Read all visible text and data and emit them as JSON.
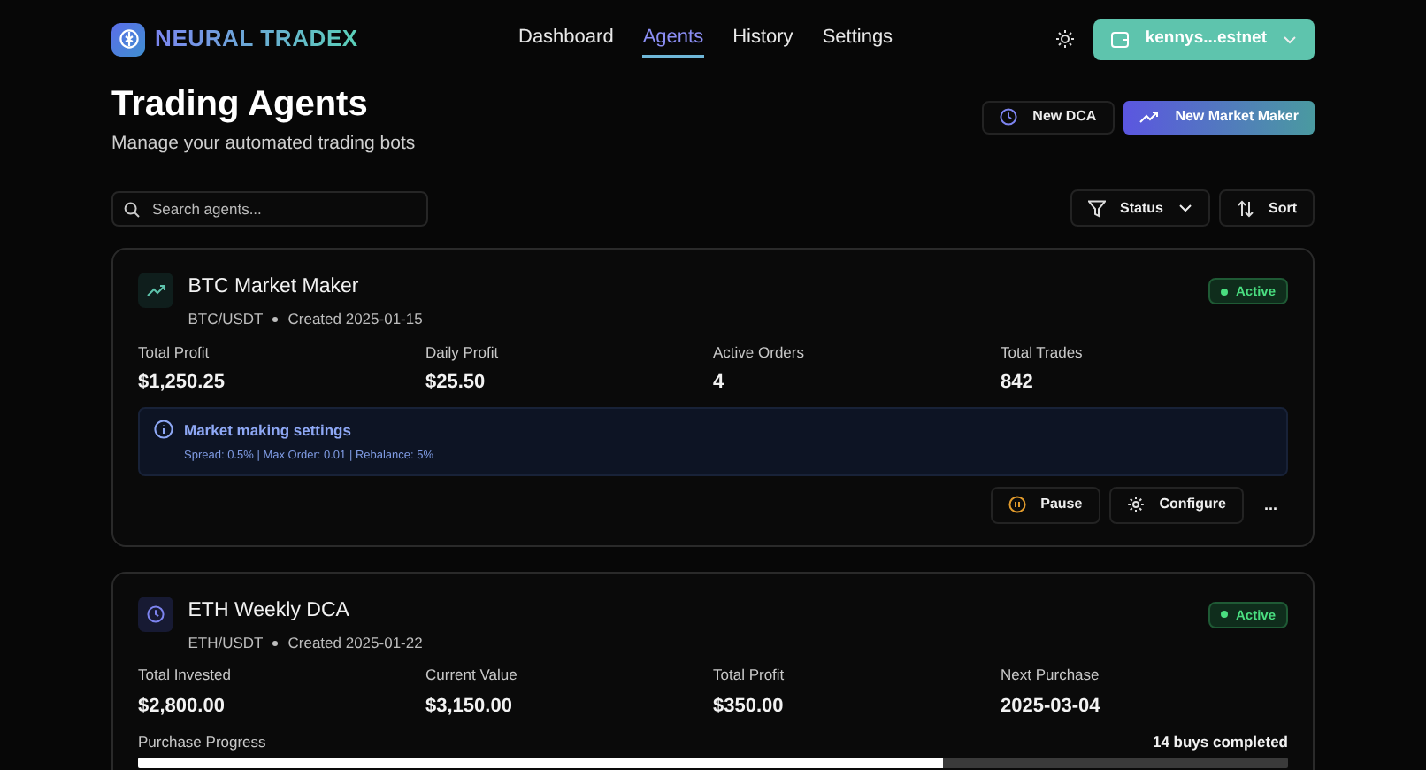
{
  "brand": {
    "name": "NEURAL TRADEX"
  },
  "nav": [
    {
      "label": "Dashboard",
      "selected": false
    },
    {
      "label": "Agents",
      "selected": true
    },
    {
      "label": "History",
      "selected": false
    },
    {
      "label": "Settings",
      "selected": false
    }
  ],
  "wallet": {
    "label": "kennys...estnet"
  },
  "header": {
    "title": "Trading Agents",
    "subtitle": "Manage your automated trading bots"
  },
  "actions": [
    {
      "kind": "dca",
      "label": "New DCA"
    },
    {
      "kind": "market_maker",
      "label": "New Market Maker"
    }
  ],
  "search": {
    "placeholder": "Search agents..."
  },
  "filters": [
    {
      "kind": "status",
      "label": "Status"
    },
    {
      "kind": "sort",
      "label": "Sort"
    }
  ],
  "agents": [
    {
      "kind": "market_maker",
      "name": "BTC Market Maker",
      "pair": "BTC/USDT",
      "created": "Created 2025-01-15",
      "status": "Active",
      "stats": [
        {
          "label": "Total Profit",
          "value": "$1,250.25"
        },
        {
          "label": "Daily Profit",
          "value": "$25.50"
        },
        {
          "label": "Active Orders",
          "value": "4"
        },
        {
          "label": "Total Trades",
          "value": "842"
        }
      ],
      "info": {
        "title": "Market making settings",
        "details": "Spread: 0.5% | Max Order: 0.01 | Rebalance: 5%"
      },
      "buttons": [
        {
          "kind": "pause",
          "label": "Pause"
        },
        {
          "kind": "configure",
          "label": "Configure"
        },
        {
          "kind": "more",
          "label": "..."
        }
      ]
    },
    {
      "kind": "dca",
      "name": "ETH Weekly DCA",
      "pair": "ETH/USDT",
      "created": "Created 2025-01-22",
      "status": "Active",
      "stats": [
        {
          "label": "Total Invested",
          "value": "$2,800.00"
        },
        {
          "label": "Current Value",
          "value": "$3,150.00"
        },
        {
          "label": "Total Profit",
          "value": "$350.00"
        },
        {
          "label": "Next Purchase",
          "value": "2025-03-04"
        }
      ],
      "progress": {
        "label": "Purchase Progress",
        "reading": "14 buys completed",
        "level": 0.7
      }
    }
  ]
}
